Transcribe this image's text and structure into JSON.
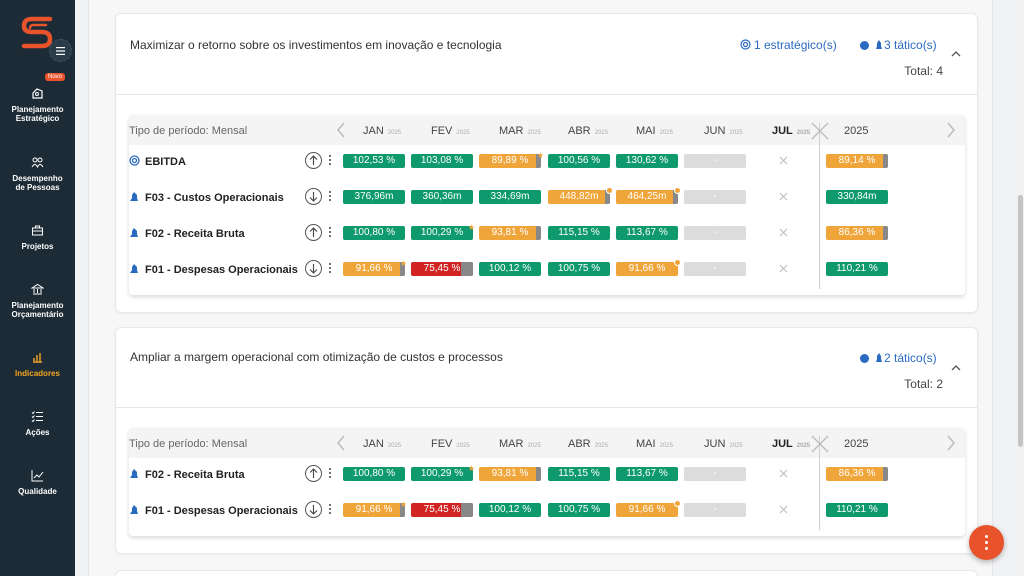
{
  "sidebar": {
    "badge": "Novo",
    "items": [
      {
        "line1": "Planejamento",
        "line2": "Estratégico",
        "icon": "strategy-icon"
      },
      {
        "line1": "Desempenho",
        "line2": "de Pessoas",
        "icon": "people-icon"
      },
      {
        "line1": "Projetos",
        "line2": "",
        "icon": "briefcase-icon"
      },
      {
        "line1": "Planejamento",
        "line2": "Orçamentário",
        "icon": "bank-icon"
      },
      {
        "line1": "Indicadores",
        "line2": "",
        "icon": "bar-chart-icon"
      },
      {
        "line1": "Ações",
        "line2": "",
        "icon": "checklist-icon"
      },
      {
        "line1": "Qualidade",
        "line2": "",
        "icon": "line-chart-icon"
      }
    ]
  },
  "colors": {
    "green": "#0f9a6e",
    "orange": "#f0a53a",
    "red": "#d32424",
    "accent": "#e8532c",
    "blue": "#2a6bc2"
  },
  "cards": [
    {
      "title": "Maximizar o retorno sobre os investimentos em inovação e tecnologia",
      "chip_strategic": "1 estratégico(s)",
      "chip_tactical": "3 tático(s)",
      "total": "Total: 4",
      "period_type": "Tipo de período: Mensal",
      "months": [
        {
          "name": "JAN",
          "year": "2025"
        },
        {
          "name": "FEV",
          "year": "2025"
        },
        {
          "name": "MAR",
          "year": "2025"
        },
        {
          "name": "ABR",
          "year": "2025"
        },
        {
          "name": "MAI",
          "year": "2025"
        },
        {
          "name": "JUN",
          "year": "2025"
        },
        {
          "name": "JUL",
          "year": "2025"
        }
      ],
      "year_col": "2025",
      "rows": [
        {
          "label": "EBITDA",
          "type": "strategic",
          "dir": "up",
          "values": [
            "102,53 %",
            "103,08 %",
            "89,89 %",
            "100,56 %",
            "130,62 %",
            "-"
          ],
          "year": "89,14 %"
        },
        {
          "label": "F03 - Custos Operacionais",
          "type": "tactical",
          "dir": "down",
          "values": [
            "376,96m",
            "360,36m",
            "334,69m",
            "448,82m",
            "464,25m",
            "-"
          ],
          "year": "330,84m"
        },
        {
          "label": "F02 - Receita Bruta",
          "type": "tactical",
          "dir": "up",
          "values": [
            "100,80 %",
            "100,29 %",
            "93,81 %",
            "115,15 %",
            "113,67 %",
            "-"
          ],
          "year": "86,36 %"
        },
        {
          "label": "F01 - Despesas Operacionais",
          "type": "tactical",
          "dir": "down",
          "values": [
            "91,66 %",
            "75,45 %",
            "100,12 %",
            "100,75 %",
            "91,66 %",
            "-"
          ],
          "year": "110,21 %"
        }
      ]
    },
    {
      "title": "Ampliar a margem operacional com otimização de custos e processos",
      "chip_tactical": "2 tático(s)",
      "total": "Total: 2",
      "period_type": "Tipo de período: Mensal",
      "months": [
        {
          "name": "JAN",
          "year": "2025"
        },
        {
          "name": "FEV",
          "year": "2025"
        },
        {
          "name": "MAR",
          "year": "2025"
        },
        {
          "name": "ABR",
          "year": "2025"
        },
        {
          "name": "MAI",
          "year": "2025"
        },
        {
          "name": "JUN",
          "year": "2025"
        },
        {
          "name": "JUL",
          "year": "2025"
        }
      ],
      "year_col": "2025",
      "rows": [
        {
          "label": "F02 - Receita Bruta",
          "type": "tactical",
          "dir": "up",
          "values": [
            "100,80 %",
            "100,29 %",
            "93,81 %",
            "115,15 %",
            "113,67 %",
            "-"
          ],
          "year": "86,36 %"
        },
        {
          "label": "F01 - Despesas Operacionais",
          "type": "tactical",
          "dir": "down",
          "values": [
            "91,66 %",
            "75,45 %",
            "100,12 %",
            "100,75 %",
            "91,66 %",
            "-"
          ],
          "year": "110,21 %"
        }
      ]
    }
  ]
}
